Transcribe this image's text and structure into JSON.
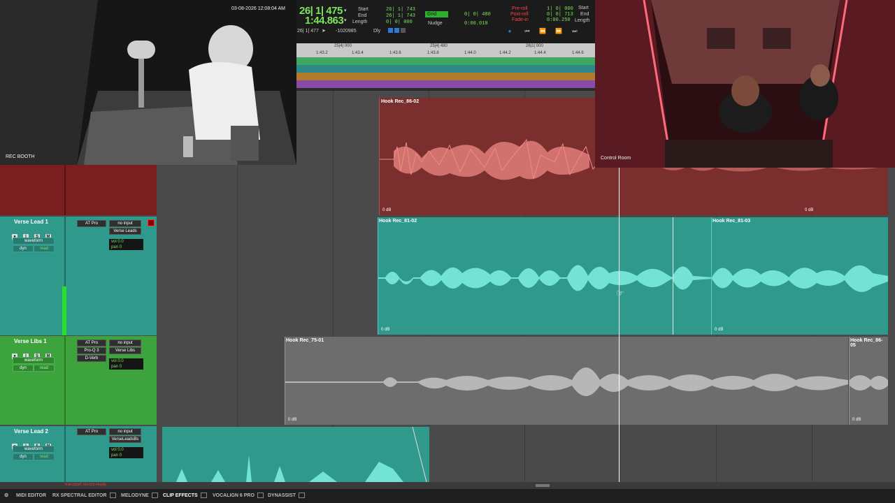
{
  "cams": {
    "left": {
      "timestamp": "03-08-2026 12:08:04 AM",
      "label": "REC BOOTH"
    },
    "right": {
      "label": "Control Room"
    }
  },
  "transport": {
    "main_bars": "26| 1| 475",
    "main_min": "1:44.863",
    "sub_counter": "26| 1| 477",
    "sub_value": "-1020985",
    "dly": "Dly",
    "start_label": "Start",
    "start_val": "26| 1| 743",
    "end_label": "End",
    "end_val": "26| 1| 743",
    "length_label": "Length",
    "length_val": "0| 0| 000",
    "grid_label": "Grid",
    "grid_val": "0| 0| 480",
    "nudge_label": "Nudge",
    "nudge_val": "0:00.010",
    "preroll_label": "Pre-roll",
    "preroll_val": "1| 0| 000",
    "postroll_label": "Post-roll",
    "postroll_val": "0| 0| 713",
    "fadein_label": "Fade-in",
    "fadein_val": "0:00.250",
    "start2_label": "Start",
    "end2_label": "End",
    "length2_label": "Length"
  },
  "ruler": {
    "bars": [
      "25|4| 000",
      "25|4| 480",
      "26|1| 000"
    ],
    "mins": [
      "1:43.2",
      "1:43.4",
      "1:43.6",
      "1:43.8",
      "1:44.0",
      "1:44.2",
      "1:44.4",
      "1:44.6"
    ]
  },
  "tracks": [
    {
      "name": "Verse Lead 1",
      "mode": "waveform",
      "dyn": "dyn",
      "read": "read",
      "inserts": [
        "AT Pro"
      ],
      "input": "no input",
      "output": "Verse Leads",
      "vol_label": "vol",
      "vol": "0.0",
      "pan_label": "pan",
      "pan": "0"
    },
    {
      "name": "Verse Libs 1",
      "mode": "waveform",
      "dyn": "dyn",
      "read": "read",
      "inserts": [
        "AT Pro",
        "Pro-Q 3",
        "D-Verb"
      ],
      "input": "no input",
      "output": "Verse Libs",
      "vol_label": "vol",
      "vol": "0.0",
      "pan_label": "pan",
      "pan": "0"
    },
    {
      "name": "Verse Lead 2",
      "mode": "waveform",
      "dyn": "dyn",
      "read": "read",
      "inserts": [
        "AT Pro"
      ],
      "input": "no input",
      "output": "VerseLeadsBs",
      "vol_label": "vol",
      "vol": "0.0",
      "pan_label": "pan",
      "pan": "0"
    }
  ],
  "clips": {
    "top": {
      "name": "Hook Rec_86-02",
      "db": "0 dB",
      "db2": "0 dB"
    },
    "lead1a": {
      "name": "Hook Rec_81-02",
      "db": "0 dB"
    },
    "lead1b": {
      "name": "Hook Rec_81-03",
      "db": "0 dB"
    },
    "libs_a": {
      "name": "Hook Rec_75-01",
      "db": "0 dB"
    },
    "libs_b": {
      "name": "Hook Rec_86-05",
      "db": "0 dB"
    }
  },
  "status": "transport record ready",
  "bottom_tabs": [
    "MIDI EDITOR",
    "RX SPECTRAL EDITOR",
    "MELODYNE",
    "CLIP EFFECTS",
    "VOCALIGN 6 PRO",
    "DYNASSIST"
  ],
  "colors": {
    "teal": "#2f9a8c",
    "teal_wave": "#7ff0e2",
    "red": "#7a2a2a",
    "red_wave": "#f08a85",
    "gray_clip": "#6d6d6d",
    "gray_wave": "#c9c9c9",
    "green": "#3da43d"
  }
}
